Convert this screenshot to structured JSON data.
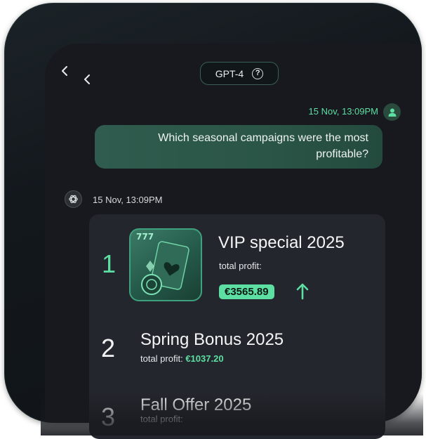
{
  "header": {
    "model_label": "GPT-4"
  },
  "user_message": {
    "timestamp": "15 Nov, 13:09PM",
    "text": "Which seasonal campaigns were the most profitable?"
  },
  "ai_message": {
    "timestamp": "15 Nov, 13:09PM",
    "campaigns": [
      {
        "rank": "1",
        "title": "VIP special 2025",
        "profit_label": "total profit:",
        "profit_value": "€3565.89"
      },
      {
        "rank": "2",
        "title": "Spring Bonus 2025",
        "profit_label": "total profit:",
        "profit_value": "€1037.20"
      },
      {
        "rank": "3",
        "title": "Fall Offer 2025",
        "profit_label": "total profit:"
      }
    ]
  },
  "colors": {
    "accent": "#5ddfa3",
    "bubble": "#2f5c4e",
    "card": "#23262c",
    "background": "#17191e"
  }
}
